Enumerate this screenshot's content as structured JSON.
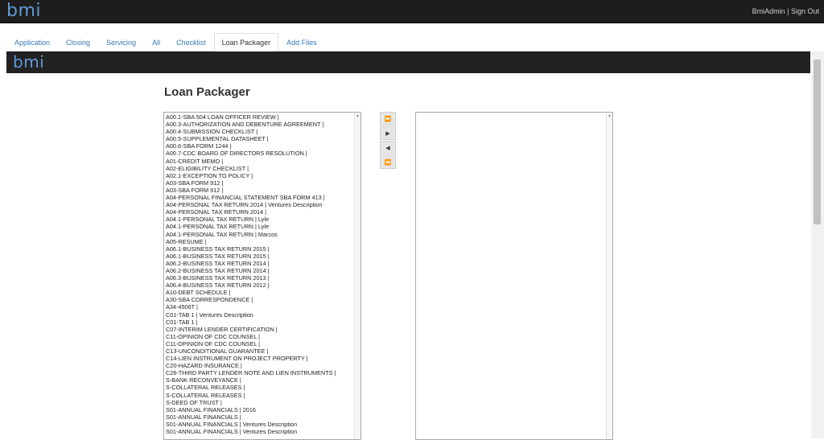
{
  "app": {
    "logo": "bmi",
    "user": "BmiAdmin",
    "separator": "|",
    "signout": "Sign Out"
  },
  "tabs": [
    {
      "label": "Application"
    },
    {
      "label": "Closing"
    },
    {
      "label": "Servicing"
    },
    {
      "label": "All"
    },
    {
      "label": "Checklist"
    },
    {
      "label": "Loan Packager",
      "active": true
    },
    {
      "label": "Add Files"
    }
  ],
  "banner": {
    "logo": "bmi"
  },
  "page": {
    "title": "Loan Packager"
  },
  "buttons": {
    "move_all_right": "⏩",
    "move_right": "▶",
    "move_left": "◀",
    "move_all_left": "⏪"
  },
  "icons": {
    "scroll_up": "▲"
  },
  "available_docs": [
    "A00.1-SBA 504 LOAN OFFICER REVIEW |",
    "A00.3-AUTHORIZATION AND DEBENTURE AGREEMENT |",
    "A00.4-SUBMISSION CHECKLIST |",
    "A00.5-SUPPLEMENTAL DATASHEET |",
    "A00.6-SBA FORM 1244 |",
    "A00.7-CDC BOARD OF DIRECTORS RESOLUTION |",
    "A01-CREDIT MEMO |",
    "A02-ELIGIBILITY CHECKLIST |",
    "A02.1-EXCEPTION TO POLICY |",
    "A03-SBA FORM 912 |",
    "A03-SBA FORM 912 |",
    "A04-PERSONAL FINANCIAL STATEMENT SBA FORM 413 |",
    "A04-PERSONAL TAX RETURN 2014 | Ventures Description",
    "A04-PERSONAL TAX RETURN 2014 |",
    "A04.1-PERSONAL TAX RETURN | Lyle",
    "A04.1-PERSONAL TAX RETURN | Lyle",
    "A04.1-PERSONAL TAX RETURN | Marcos",
    "A05-RESUME |",
    "A06.1-BUSINESS TAX RETURN 2015 |",
    "A06.1-BUSINESS TAX RETURN 2015 |",
    "A06.2-BUSINESS TAX RETURN 2014 |",
    "A06.2-BUSINESS TAX RETURN 2014 |",
    "A06.3-BUSINESS TAX RETURN 2013 |",
    "A06.4-BUSINESS TAX RETURN 2012 |",
    "A10-DEBT SCHEDULE |",
    "A30-SBA CORRESPONDENCE |",
    "A34-4506T |",
    "C01-TAB 1 | Ventures Description",
    "C01-TAB 1 |",
    "C07-INTERIM LENDER CERTIFICATION |",
    "C11-OPINION OF CDC COUNSEL |",
    "C11-OPINION OF CDC COUNSEL |",
    "C13-UNCONDITIONAL GUARANTEE |",
    "C14-LIEN INSTRUMENT ON PROJECT PROPERTY |",
    "C20-HAZARD INSURANCE |",
    "C26-THIRD PARTY LENDER NOTE AND LIEN INSTRUMENTS |",
    "S-BANK RECONVEYANCE |",
    "S-COLLATERAL RELEASES |",
    "S-COLLATERAL RELEASES |",
    "S-DEED OF TRUST |",
    "S01-ANNUAL FINANCIALS | 2016",
    "S01-ANNUAL FINANCIALS |",
    "S01-ANNUAL FINANCIALS | Ventures Description",
    "S01-ANNUAL FINANCIALS | Ventures Description"
  ],
  "selected_docs": []
}
